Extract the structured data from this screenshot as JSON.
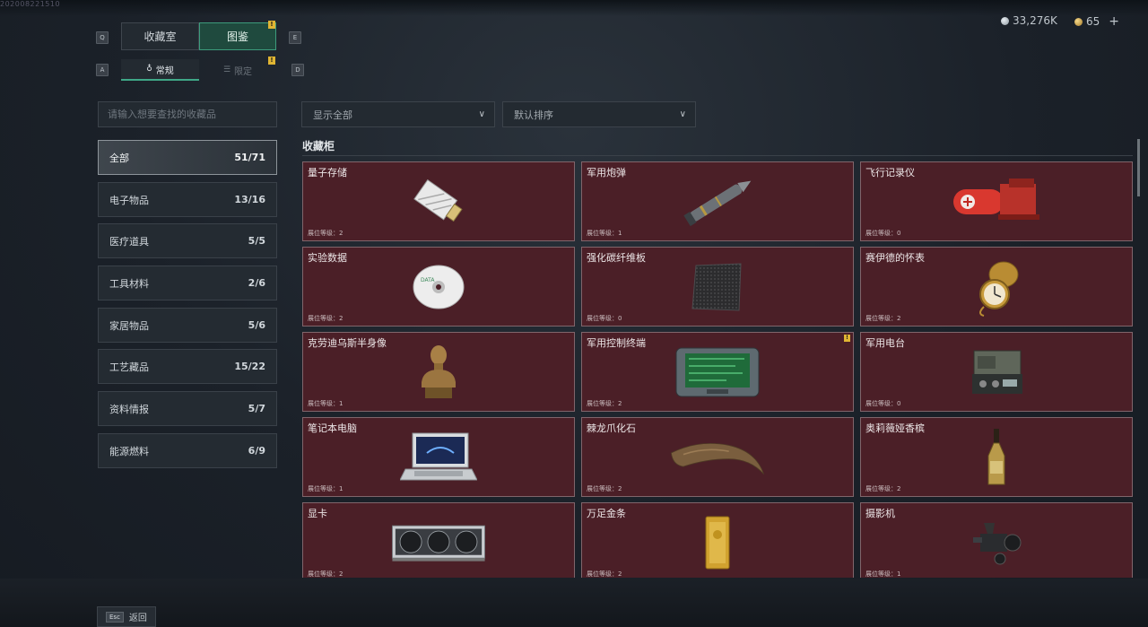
{
  "header": {
    "watermark": "202008221510",
    "currency_1": "33,276K",
    "currency_2": "65",
    "add_symbol": "+"
  },
  "keys": {
    "q": "Q",
    "e": "E",
    "a": "A",
    "d": "D"
  },
  "tabs": [
    {
      "label": "收藏室",
      "active": false
    },
    {
      "label": "图鉴",
      "active": true,
      "badge": "!"
    }
  ],
  "subtabs": [
    {
      "label": "常规",
      "active": true,
      "badge": "!"
    },
    {
      "label": "限定",
      "active": false
    }
  ],
  "search": {
    "placeholder": "请输入想要查找的收藏品"
  },
  "categories": [
    {
      "label": "全部",
      "count": "51/71",
      "active": true
    },
    {
      "label": "电子物品",
      "count": "13/16"
    },
    {
      "label": "医疗道具",
      "count": "5/5"
    },
    {
      "label": "工具材料",
      "count": "2/6"
    },
    {
      "label": "家居物品",
      "count": "5/6"
    },
    {
      "label": "工艺藏品",
      "count": "15/22"
    },
    {
      "label": "资料情报",
      "count": "5/7"
    },
    {
      "label": "能源燃料",
      "count": "6/9"
    }
  ],
  "filters": {
    "show": "显示全部",
    "sort": "默认排序"
  },
  "section_title": "收藏柜",
  "items": [
    {
      "name": "量子存储",
      "level": "展位等级：2",
      "icon": "usb-drive-icon"
    },
    {
      "name": "军用炮弹",
      "level": "展位等级：1",
      "icon": "shell-icon"
    },
    {
      "name": "飞行记录仪",
      "level": "展位等级：0",
      "icon": "flight-recorder-icon"
    },
    {
      "name": "实验数据",
      "level": "展位等级：2",
      "icon": "disc-icon"
    },
    {
      "name": "强化碳纤维板",
      "level": "展位等级：0",
      "icon": "carbon-plate-icon"
    },
    {
      "name": "赛伊德的怀表",
      "level": "展位等级：2",
      "icon": "pocket-watch-icon"
    },
    {
      "name": "克劳迪乌斯半身像",
      "level": "展位等级：1",
      "icon": "bust-icon"
    },
    {
      "name": "军用控制终端",
      "level": "展位等级：2",
      "icon": "terminal-icon",
      "badge": "!"
    },
    {
      "name": "军用电台",
      "level": "展位等级：0",
      "icon": "radio-icon"
    },
    {
      "name": "笔记本电脑",
      "level": "展位等级：1",
      "icon": "laptop-icon"
    },
    {
      "name": "棘龙爪化石",
      "level": "展位等级：2",
      "icon": "claw-fossil-icon"
    },
    {
      "name": "奥莉薇娅香槟",
      "level": "展位等级：2",
      "icon": "champagne-icon"
    },
    {
      "name": "显卡",
      "level": "展位等级：2",
      "icon": "gpu-icon"
    },
    {
      "name": "万足金条",
      "level": "展位等级：2",
      "icon": "gold-bar-icon"
    },
    {
      "name": "摄影机",
      "level": "展位等级：1",
      "icon": "camera-icon"
    }
  ],
  "footer": {
    "esc_key": "Esc",
    "back_label": "返回"
  },
  "colors": {
    "accent": "#3fa887",
    "card_bg": "#4b1f27",
    "badge": "#e0b533"
  }
}
